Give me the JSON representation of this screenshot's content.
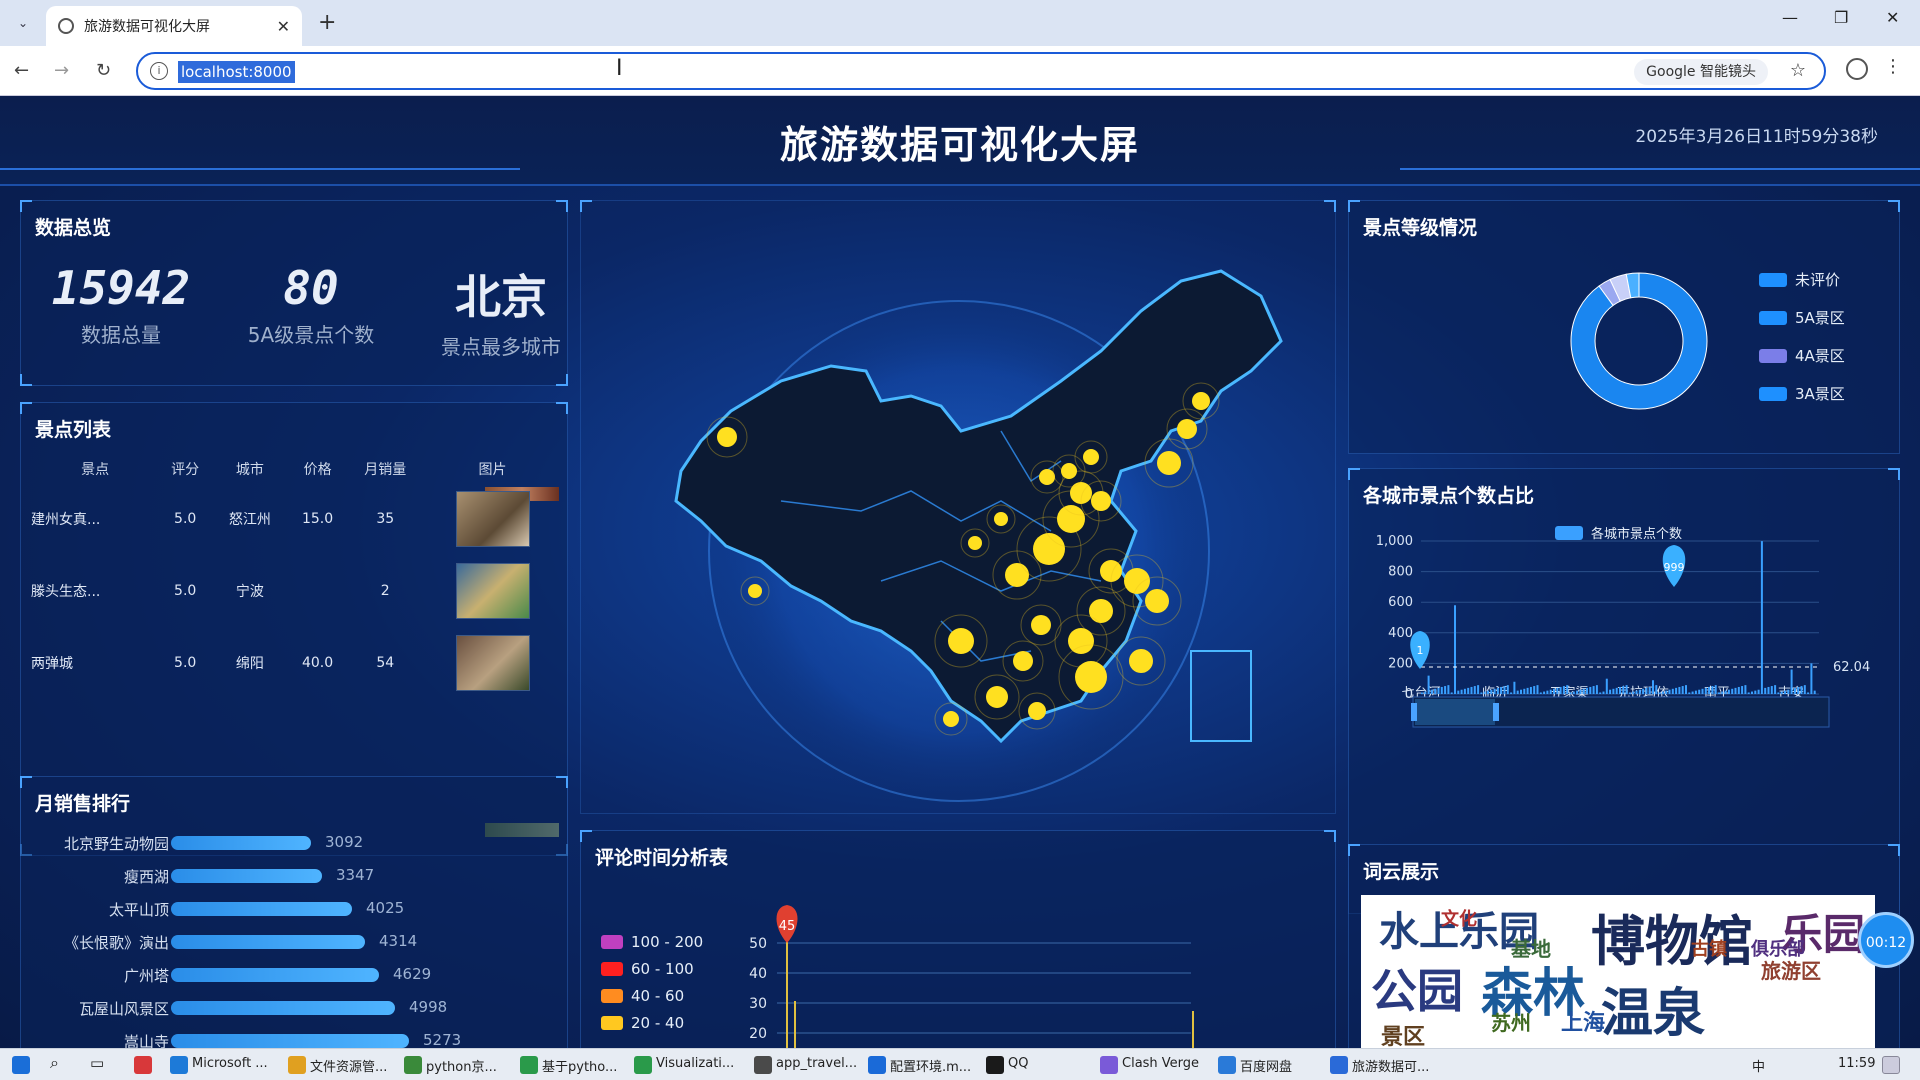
{
  "browser": {
    "tab_title": "旅游数据可视化大屏",
    "url": "localhost:8000",
    "lens_label": "Google 智能镜头"
  },
  "header": {
    "title": "旅游数据可视化大屏",
    "datetime": "2025年3月26日11时59分38秒"
  },
  "overview": {
    "title": "数据总览",
    "total_value": "15942",
    "total_label": "数据总量",
    "fivea_value": "80",
    "fivea_label": "5A级景点个数",
    "topcity_value": "北京",
    "topcity_label": "景点最多城市"
  },
  "spot_list": {
    "title": "景点列表",
    "headers": [
      "景点",
      "评分",
      "城市",
      "价格",
      "月销量",
      "图片"
    ],
    "rows": [
      {
        "name": "建州女真...",
        "score": "5.0",
        "city": "怒江州",
        "price": "15.0",
        "sales": "35"
      },
      {
        "name": "滕头生态...",
        "score": "5.0",
        "city": "宁波",
        "price": "",
        "sales": "2"
      },
      {
        "name": "两弹城",
        "score": "5.0",
        "city": "绵阳",
        "price": "40.0",
        "sales": "54"
      }
    ]
  },
  "sales_rank": {
    "title": "月销售排行",
    "items": [
      {
        "name": "北京野生动物园",
        "value": "3092",
        "pct": 0.52
      },
      {
        "name": "瘦西湖",
        "value": "3347",
        "pct": 0.56
      },
      {
        "name": "太平山顶",
        "value": "4025",
        "pct": 0.67
      },
      {
        "name": "《长恨歌》演出",
        "value": "4314",
        "pct": 0.72
      },
      {
        "name": "广州塔",
        "value": "4629",
        "pct": 0.77
      },
      {
        "name": "瓦屋山风景区",
        "value": "4998",
        "pct": 0.83
      },
      {
        "name": "嵩山寺",
        "value": "5273",
        "pct": 0.88
      }
    ]
  },
  "level_panel": {
    "title": "景点等级情况",
    "legend": [
      {
        "label": "未评价",
        "color": "#1e90ff"
      },
      {
        "label": "5A景区",
        "color": "#1e90ff"
      },
      {
        "label": "4A景区",
        "color": "#7b7ee8"
      },
      {
        "label": "3A景区",
        "color": "#1e90ff"
      }
    ],
    "slices": [
      {
        "label": "未评价",
        "value": 0.9,
        "color": "#1a86f0"
      },
      {
        "label": "5A景区",
        "value": 0.03,
        "color": "#9aa8f0"
      },
      {
        "label": "4A景区",
        "value": 0.04,
        "color": "#c8d0f8"
      },
      {
        "label": "3A景区",
        "value": 0.03,
        "color": "#4ab0ff"
      }
    ]
  },
  "city_ratio": {
    "title": "各城市景点个数占比",
    "legend": "各城市景点个数",
    "max_label": "999",
    "min_label": "1",
    "avg_label": "62.04",
    "x_labels": [
      "七台河",
      "临沂",
      "五家渠",
      "克拉玛依",
      "南平",
      "吉安"
    ],
    "y_ticks": [
      "1,000",
      "800",
      "600",
      "400",
      "200",
      "0"
    ]
  },
  "comment_time": {
    "title": "评论时间分析表",
    "legend": [
      {
        "label": "100 - 200",
        "color": "#c040c0"
      },
      {
        "label": "60 - 100",
        "color": "#ff2020"
      },
      {
        "label": "40 - 60",
        "color": "#ff8c20"
      },
      {
        "label": "20 - 40",
        "color": "#ffc820"
      }
    ],
    "y_ticks": [
      "50",
      "40",
      "30",
      "20"
    ],
    "max_label": "45"
  },
  "wordcloud": {
    "title": "词云展示",
    "words": [
      "水上乐园",
      "博物馆",
      "温泉",
      "公园",
      "森林",
      "文化",
      "基地",
      "旅游区",
      "乐园",
      "苏州",
      "上海",
      "俱乐部",
      "古镇",
      "景区"
    ]
  },
  "recording": {
    "timer": "00:12"
  },
  "taskbar": {
    "items": [
      "Microsoft ...",
      "文件资源管...",
      "python京...",
      "基于pytho...",
      "Visualizati...",
      "app_travel...",
      "配置环境.m...",
      "QQ",
      "Clash Verge",
      "百度网盘",
      "旅游数据可..."
    ],
    "clock": "11:59",
    "ime": "中"
  }
}
